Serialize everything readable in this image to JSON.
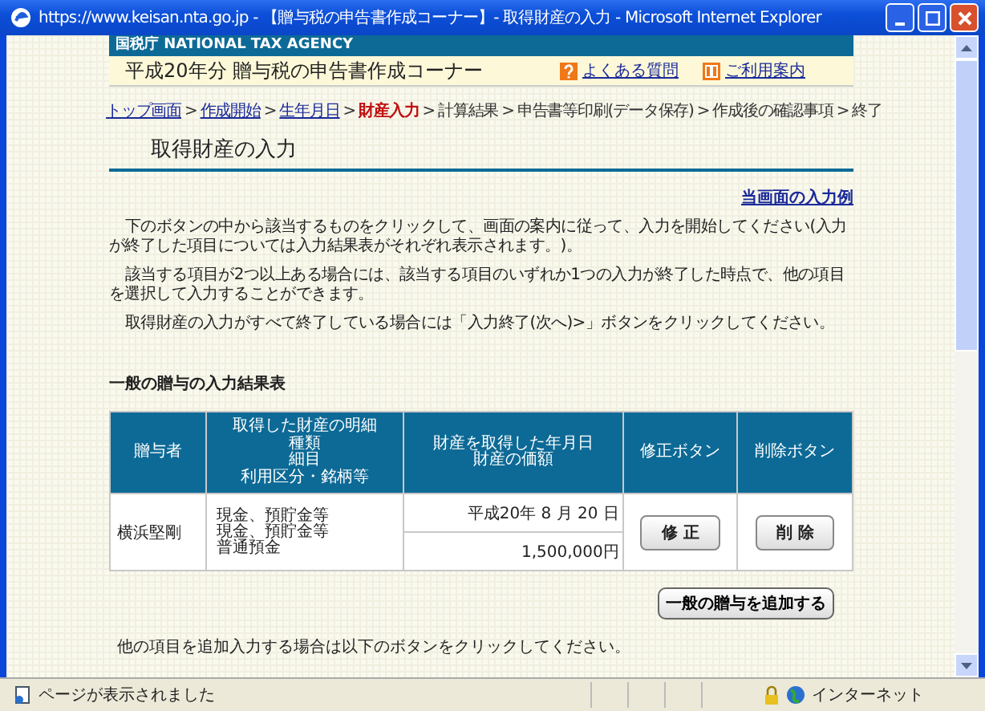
{
  "window": {
    "title": "https://www.keisan.nta.go.jp - 【贈与税の申告書作成コーナー】- 取得財産の入力 - Microsoft Internet Explorer"
  },
  "agency_bar": "国税庁 NATIONAL TAX AGENCY",
  "site_header": {
    "title": "平成20年分 贈与税の申告書作成コーナー",
    "links": [
      {
        "label": "よくある質問",
        "kind": "faq"
      },
      {
        "label": "ご利用案内",
        "kind": "guide"
      }
    ]
  },
  "breadcrumb": [
    {
      "label": "トップ画面",
      "kind": "link"
    },
    {
      "label": "作成開始",
      "kind": "link"
    },
    {
      "label": "生年月日",
      "kind": "link"
    },
    {
      "label": "財産入力",
      "kind": "current"
    },
    {
      "label": "計算結果",
      "kind": "plain"
    },
    {
      "label": "申告書等印刷(データ保存)",
      "kind": "plain"
    },
    {
      "label": "作成後の確認事項",
      "kind": "plain"
    },
    {
      "label": "終了",
      "kind": "plain"
    }
  ],
  "breadcrumb_separator": ">",
  "page_title": "取得財産の入力",
  "example_link": "当画面の入力例",
  "paragraphs": [
    "下のボタンの中から該当するものをクリックして、画面の案内に従って、入力を開始してください(入力が終了した項目については入力結果表がそれぞれ表示されます。)。",
    "該当する項目が2つ以上ある場合には、該当する項目のいずれか1つの入力が終了した時点で、他の項目を選択して入力することができます。",
    "取得財産の入力がすべて終了している場合には「入力終了(次へ)>」ボタンをクリックしてください。"
  ],
  "section_title": "一般の贈与の入力結果表",
  "table": {
    "columns": [
      [
        "贈与者"
      ],
      [
        "取得した財産の明細",
        "種類",
        "細目",
        "利用区分・銘柄等"
      ],
      [
        "財産を取得した年月日",
        "財産の価額"
      ],
      [
        "修正ボタン"
      ],
      [
        "削除ボタン"
      ]
    ],
    "rows": [
      {
        "donor": "横浜堅剛",
        "details": [
          "現金、預貯金等",
          "現金、預貯金等",
          "普通預金"
        ],
        "date": "平成20年 8 月 20 日",
        "value": "1,500,000円",
        "edit_button": "修 正",
        "delete_button": "削 除"
      }
    ]
  },
  "add_button": "一般の贈与を追加する",
  "footer_text": "他の項目を追加入力する場合は以下のボタンをクリックしてください。",
  "status_bar": {
    "text": "ページが表示されました",
    "zone": "インターネット"
  }
}
